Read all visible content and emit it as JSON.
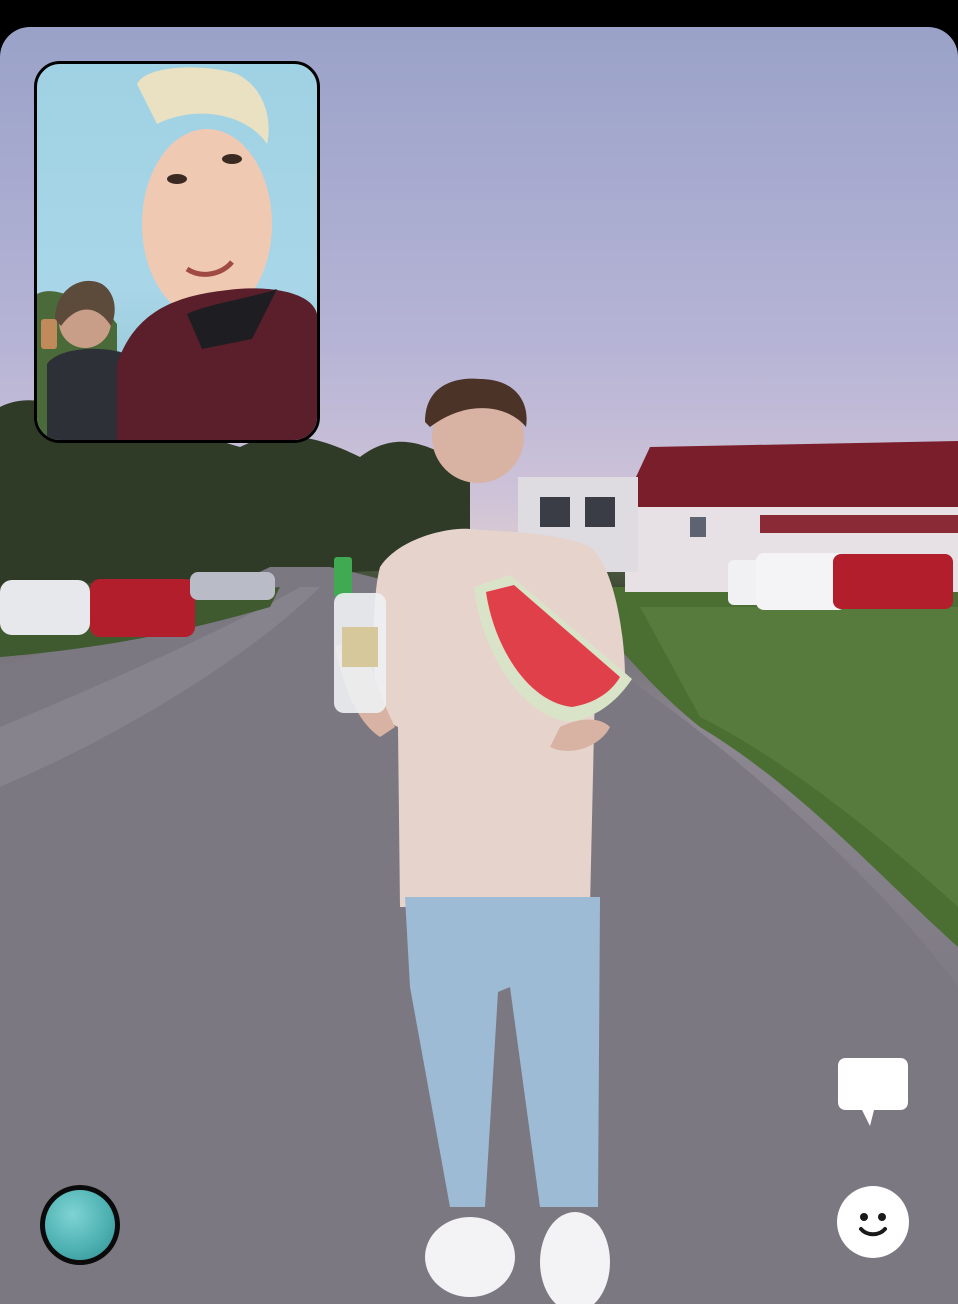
{
  "screen": {
    "title": "",
    "background_color": "#000000"
  },
  "main_photo": {
    "description_icon": "photo-main",
    "accent_colors": {
      "roof": "#7a1e2c",
      "car_red": "#b21e2c",
      "watermelon": "#e0404a",
      "shirt": "#e6d4cc",
      "jeans": "#9ebbd6"
    }
  },
  "pip_photo": {
    "description_icon": "photo-selfie"
  },
  "controls": {
    "chat_icon": "chat-bubble-icon",
    "emoji_icon": "smiley-icon",
    "avatar_icon": "avatar-icon",
    "icon_color": "#ffffff"
  }
}
